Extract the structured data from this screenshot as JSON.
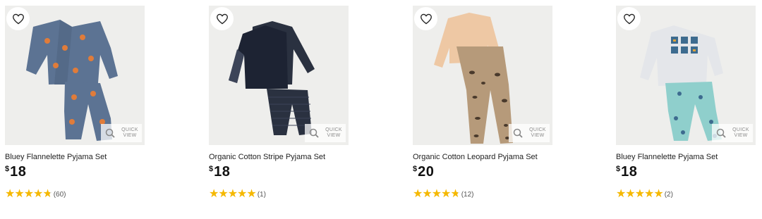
{
  "products": [
    {
      "title": "Bluey Flannelette Pyjama Set",
      "currency": "$",
      "price": "18",
      "rating": 4.8,
      "review_count": "(60)",
      "quick_view": "QUICK VIEW",
      "colors": {
        "top": "#5c7393",
        "bottom": "#5c7393",
        "accent": "#e07c3a"
      }
    },
    {
      "title": "Organic Cotton Stripe Pyjama Set",
      "currency": "$",
      "price": "18",
      "rating": 5,
      "review_count": "(1)",
      "quick_view": "QUICK VIEW",
      "colors": {
        "top": "#1d2333",
        "bottom": "#2a3140",
        "accent": "#3c4458"
      }
    },
    {
      "title": "Organic Cotton Leopard Pyjama Set",
      "currency": "$",
      "price": "20",
      "rating": 4.8,
      "review_count": "(12)",
      "quick_view": "QUICK VIEW",
      "colors": {
        "top": "#eec8a4",
        "bottom": "#b69a7a",
        "accent": "#4a3a2c"
      }
    },
    {
      "title": "Bluey Flannelette Pyjama Set",
      "currency": "$",
      "price": "18",
      "rating": 5,
      "review_count": "(2)",
      "quick_view": "QUICK VIEW",
      "colors": {
        "top": "#e4e6ea",
        "bottom": "#8fcfcc",
        "accent": "#3d6b8f"
      }
    }
  ],
  "star_color": "#f5b800"
}
